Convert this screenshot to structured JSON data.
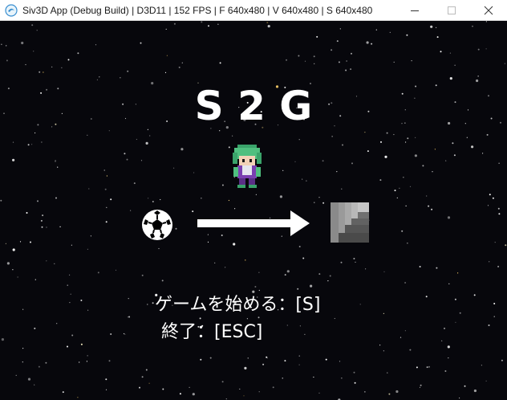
{
  "window": {
    "title": "Siv3D App (Debug Build) | D3D11 | 152 FPS | F 640x480 | V 640x480 | S 640x480",
    "icon": "siv3d-app-icon",
    "controls": [
      "minimize-icon",
      "maximize-icon",
      "close-icon"
    ]
  },
  "game": {
    "title": "S 2 G",
    "menu": {
      "start": "ゲームを始める：[S]",
      "quit": "終了：[ESC]"
    },
    "sprites": [
      "hero-character",
      "soccer-ball",
      "arrow-right",
      "goal-stairs"
    ]
  },
  "colors": {
    "background": "#07070c",
    "text": "#ffffff",
    "hero_hair": "#4fbf7f"
  }
}
